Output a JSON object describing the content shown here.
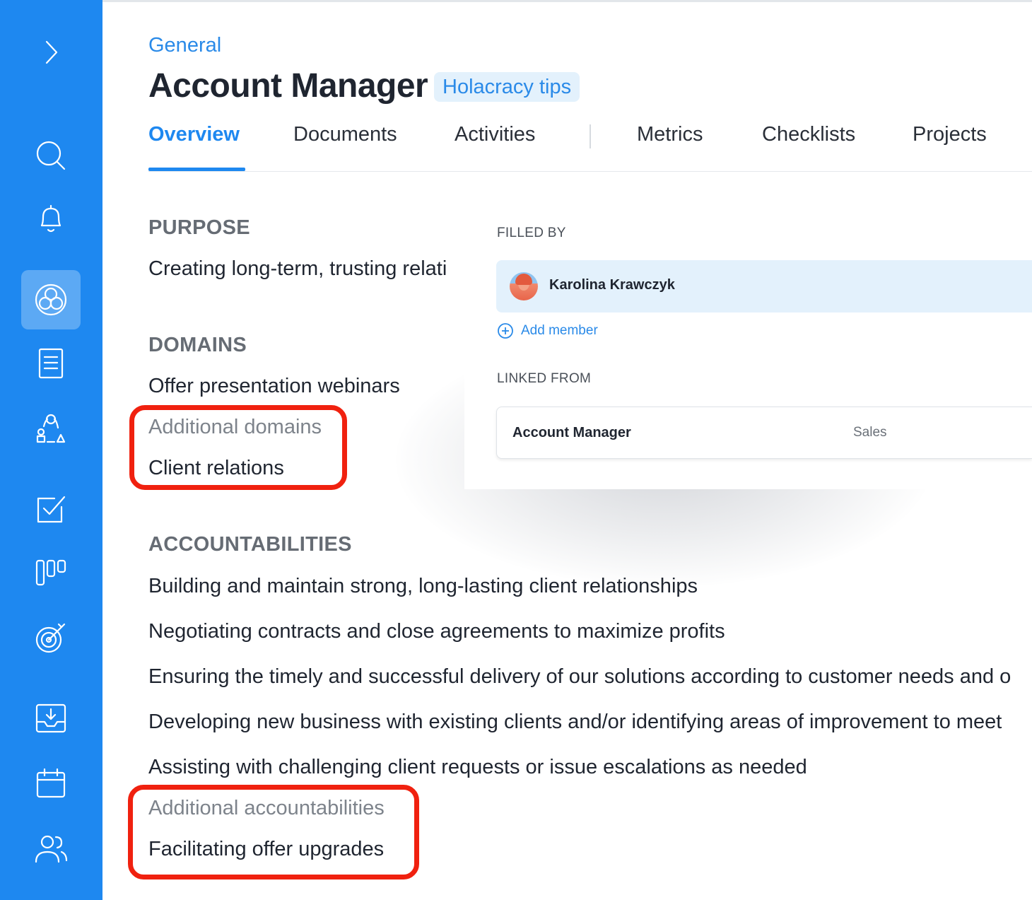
{
  "header": {
    "breadcrumb": "General",
    "title": "Account Manager",
    "tips_label": "Holacracy tips"
  },
  "tabs": [
    {
      "label": "Overview",
      "active": true
    },
    {
      "label": "Documents"
    },
    {
      "label": "Activities"
    },
    {
      "label": "Metrics"
    },
    {
      "label": "Checklists"
    },
    {
      "label": "Projects"
    }
  ],
  "sidebar": {
    "icons": [
      "chevron-right-icon",
      "search-icon",
      "bell-icon",
      "circles-icon",
      "document-icon",
      "roles-icon",
      "checkbox-icon",
      "kanban-icon",
      "target-icon",
      "inbox-icon",
      "calendar-icon",
      "users-icon"
    ],
    "active": "circles-icon"
  },
  "purpose": {
    "heading": "PURPOSE",
    "text": "Creating long-term, trusting relati"
  },
  "domains": {
    "heading": "DOMAINS",
    "items": [
      "Offer presentation webinars"
    ],
    "additional_label": "Additional domains",
    "additional_items": [
      "Client relations"
    ]
  },
  "accountabilities": {
    "heading": "ACCOUNTABILITIES",
    "items": [
      "Building and maintain strong, long-lasting client relationships",
      "Negotiating contracts and close agreements to maximize profits",
      "Ensuring the timely and successful delivery of our solutions according to customer needs and o",
      "Developing new business with existing clients and/or identifying areas of improvement to meet",
      "Assisting with challenging client requests or issue escalations as needed"
    ],
    "additional_label": "Additional accountabilities",
    "additional_items": [
      "Facilitating offer upgrades"
    ]
  },
  "card": {
    "filled_by_label": "FILLED BY",
    "member_name": "Karolina Krawczyk",
    "add_member_label": "Add member",
    "linked_from_label": "LINKED FROM",
    "linked_role": "Account Manager",
    "linked_circle": "Sales"
  },
  "colors": {
    "sidebar": "#1e88f0",
    "accent": "#2a8ae8",
    "highlight": "#f0210f"
  }
}
